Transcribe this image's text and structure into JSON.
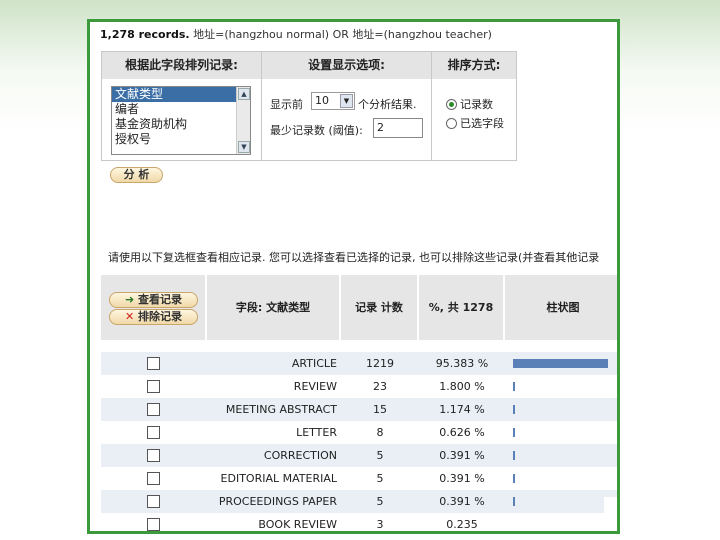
{
  "records_count": "1,278 records.",
  "query": "地址=(hangzhou normal) OR 地址=(hangzhou teacher)",
  "options": {
    "sort_field_header": "根据此字段排列记录:",
    "display_header": "设置显示选项:",
    "sort_method_header": "排序方式:",
    "field_list": [
      "文献类型",
      "编者",
      "基金资助机构",
      "授权号"
    ],
    "selected_field": "文献类型",
    "show_prefix": "显示前",
    "show_value": "10",
    "show_suffix": "个分析结果.",
    "min_label": "最少记录数 (阈值):",
    "min_value": "2",
    "sort_by_count": "记录数",
    "sort_by_field": "已选字段",
    "analyze_button": "分 析"
  },
  "instructions": "请使用以下复选框查看相应记录. 您可以选择查看已选择的记录, 也可以排除这些记录(并查看其他记录",
  "table": {
    "view_button": "查看记录",
    "exclude_button": "排除记录",
    "col_field": "字段: 文献类型",
    "col_count": "记录 计数",
    "col_percent": "%, 共 1278",
    "col_bar": "柱状图",
    "rows": [
      {
        "label": "ARTICLE",
        "count": "1219",
        "percent": "95.383 %",
        "fraction": 0.95383
      },
      {
        "label": "REVIEW",
        "count": "23",
        "percent": "1.800 %",
        "fraction": 0.018
      },
      {
        "label": "MEETING ABSTRACT",
        "count": "15",
        "percent": "1.174 %",
        "fraction": 0.01174
      },
      {
        "label": "LETTER",
        "count": "8",
        "percent": "0.626 %",
        "fraction": 0.00626
      },
      {
        "label": "CORRECTION",
        "count": "5",
        "percent": "0.391 %",
        "fraction": 0.00391
      },
      {
        "label": "EDITORIAL MATERIAL",
        "count": "5",
        "percent": "0.391 %",
        "fraction": 0.00391
      },
      {
        "label": "PROCEEDINGS PAPER",
        "count": "5",
        "percent": "0.391 %",
        "fraction": 0.00391
      },
      {
        "label": "BOOK REVIEW",
        "count": "3",
        "percent": "0.235",
        "fraction": null
      }
    ]
  },
  "colors": {
    "frame": "#3c9a3c",
    "highlight": "#d62020",
    "bar": "#5a80b8",
    "selected": "#3a6ea5"
  }
}
